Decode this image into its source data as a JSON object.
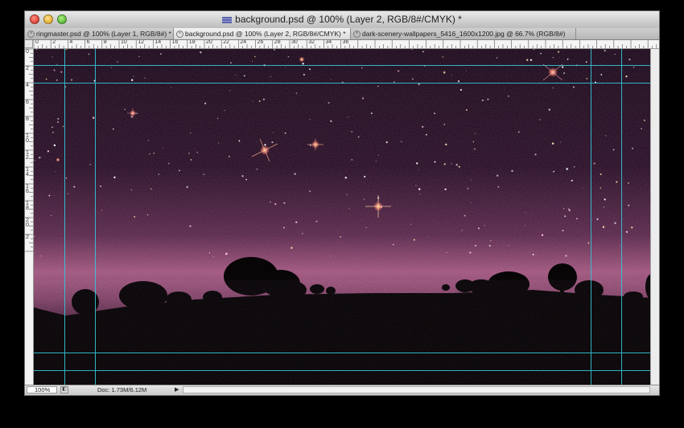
{
  "window": {
    "title": "background.psd @ 100% (Layer 2, RGB/8#/CMYK) *"
  },
  "tabs": [
    {
      "label": "ringmaster.psd @ 100% (Layer 1, RGB/8#) *",
      "active": false
    },
    {
      "label": "background.psd @ 100% (Layer 2, RGB/8#/CMYK) *",
      "active": true
    },
    {
      "label": "dark-scenery-wallpapers_5416_1600x1200.jpg @ 66.7% (RGB/8#)",
      "active": false
    }
  ],
  "rulers": {
    "top_labels": [
      "0",
      "2",
      "4",
      "6",
      "8",
      "10",
      "12",
      "14",
      "16",
      "18",
      "20",
      "22",
      "24",
      "26",
      "28",
      "30",
      "32",
      "34",
      "36"
    ],
    "left_labels": [
      "0",
      "2",
      "4",
      "6",
      "8",
      "10",
      "12",
      "14",
      "16",
      "18",
      "20",
      "2"
    ]
  },
  "status": {
    "zoom": "100%",
    "doc_size": "Doc: 1.73M/6.12M"
  },
  "colors": {
    "guide": "#34c8d8",
    "sky_top": "#1a0c18",
    "sky_band": "#a0577e",
    "ground": "#0a0608"
  },
  "icons": {
    "close": "close-icon",
    "minimize": "minimize-icon",
    "zoom": "zoom-icon",
    "tab_close": "tab-close-icon",
    "document": "document-icon"
  }
}
